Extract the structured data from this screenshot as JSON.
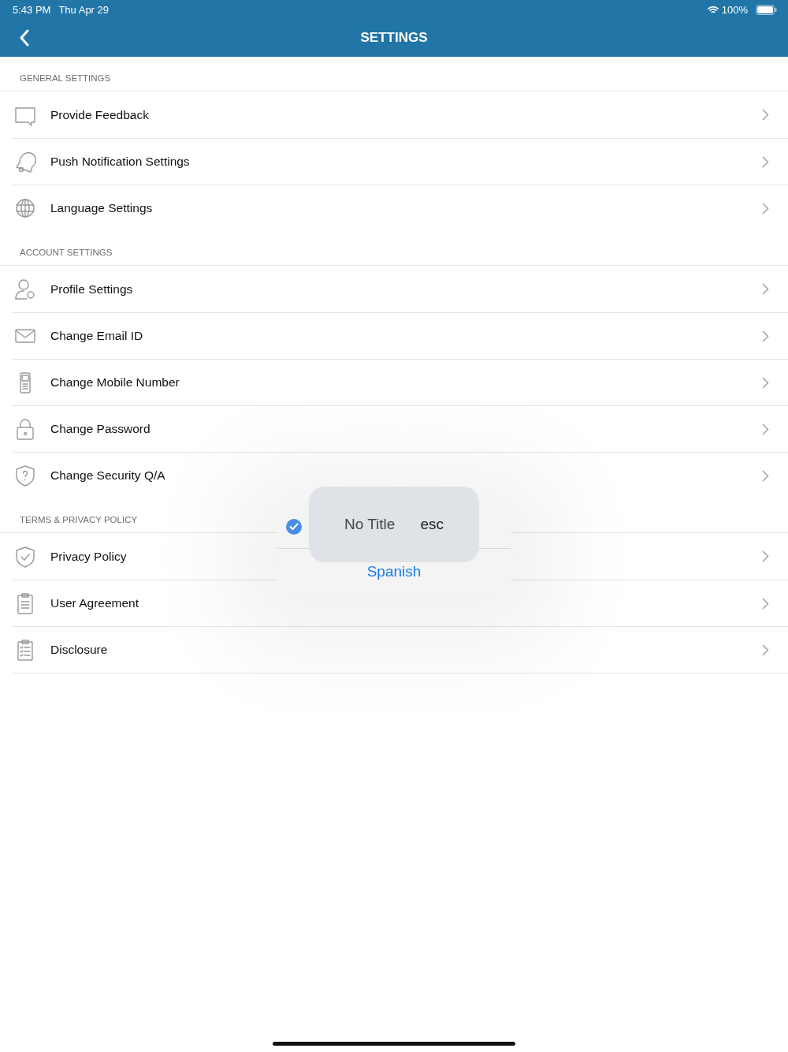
{
  "status_bar": {
    "time": "5:43 PM",
    "date": "Thu Apr 29",
    "battery": "100%"
  },
  "nav_bar": {
    "title": "SETTINGS"
  },
  "sections": [
    {
      "title": "GENERAL SETTINGS",
      "items": [
        {
          "label": "Provide Feedback"
        },
        {
          "label": "Push Notification Settings"
        },
        {
          "label": "Language Settings"
        }
      ]
    },
    {
      "title": "ACCOUNT SETTINGS",
      "items": [
        {
          "label": "Profile Settings"
        },
        {
          "label": "Change Email ID"
        },
        {
          "label": "Change Mobile Number"
        },
        {
          "label": "Change Password"
        },
        {
          "label": "Change Security Q/A"
        }
      ]
    },
    {
      "title": "TERMS & PRIVACY POLICY",
      "items": [
        {
          "label": "Privacy Policy"
        },
        {
          "label": "User Agreement"
        },
        {
          "label": "Disclosure"
        }
      ]
    }
  ],
  "popup": {
    "checked": true,
    "title": "No Title",
    "key": "esc",
    "option": "Spanish"
  }
}
